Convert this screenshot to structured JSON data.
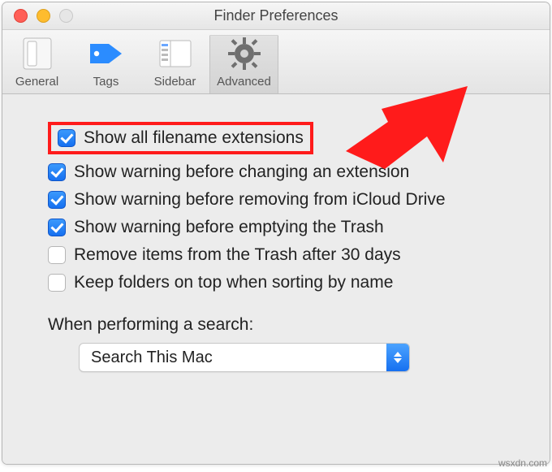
{
  "window": {
    "title": "Finder Preferences"
  },
  "toolbar": {
    "items": [
      {
        "label": "General"
      },
      {
        "label": "Tags"
      },
      {
        "label": "Sidebar"
      },
      {
        "label": "Advanced"
      }
    ]
  },
  "options": [
    {
      "label": "Show all filename extensions",
      "checked": true
    },
    {
      "label": "Show warning before changing an extension",
      "checked": true
    },
    {
      "label": "Show warning before removing from iCloud Drive",
      "checked": true
    },
    {
      "label": "Show warning before emptying the Trash",
      "checked": true
    },
    {
      "label": "Remove items from the Trash after 30 days",
      "checked": false
    },
    {
      "label": "Keep folders on top when sorting by name",
      "checked": false
    }
  ],
  "search": {
    "section_label": "When performing a search:",
    "selected": "Search This Mac"
  },
  "watermark": "wsxdn.com"
}
